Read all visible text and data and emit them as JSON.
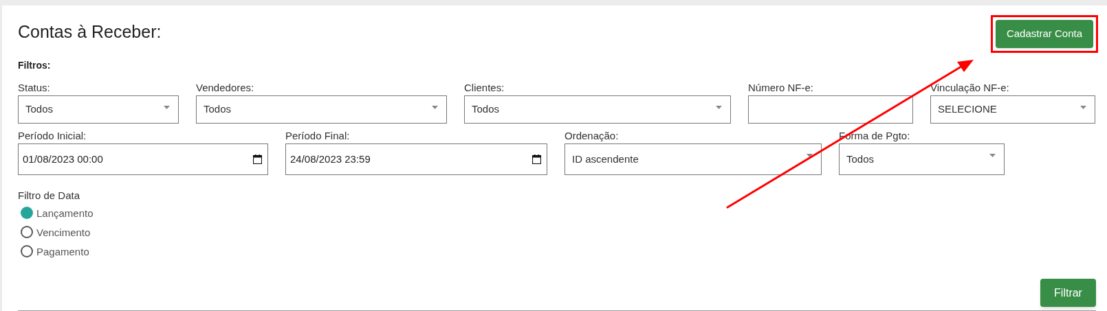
{
  "title": "Contas à Receber:",
  "primary_button": {
    "label": "Cadastrar Conta",
    "highlighted": true
  },
  "filters_heading": "Filtros:",
  "rows": [
    [
      {
        "label": "Status:",
        "kind": "select",
        "value": "Todos"
      },
      {
        "label": "Vendedores:",
        "kind": "select",
        "value": "Todos"
      },
      {
        "label": "Clientes:",
        "kind": "select",
        "value": "Todos"
      },
      {
        "label": "Número NF-e:",
        "kind": "text"
      },
      {
        "label": "Vinculação NF-e:",
        "kind": "select",
        "value": "SELECIONE"
      }
    ],
    [
      {
        "label": "Período Inicial:",
        "kind": "datetime",
        "value": "01/08/2023 00:00"
      },
      {
        "label": "Período Final:",
        "kind": "datetime",
        "value": "24/08/2023 23:59"
      },
      {
        "label": "Ordenação:",
        "kind": "select",
        "value": "ID ascendente"
      },
      {
        "label": "Forma de Pgto:",
        "kind": "select",
        "value": "Todos"
      }
    ]
  ],
  "date_filter": {
    "label": "Filtro de Data",
    "options": [
      {
        "label": "Lançamento",
        "selected": true
      },
      {
        "label": "Vencimento",
        "selected": false
      },
      {
        "label": "Pagamento",
        "selected": false
      }
    ]
  },
  "filter_button": "Filtrar",
  "annotation_arrow": true
}
